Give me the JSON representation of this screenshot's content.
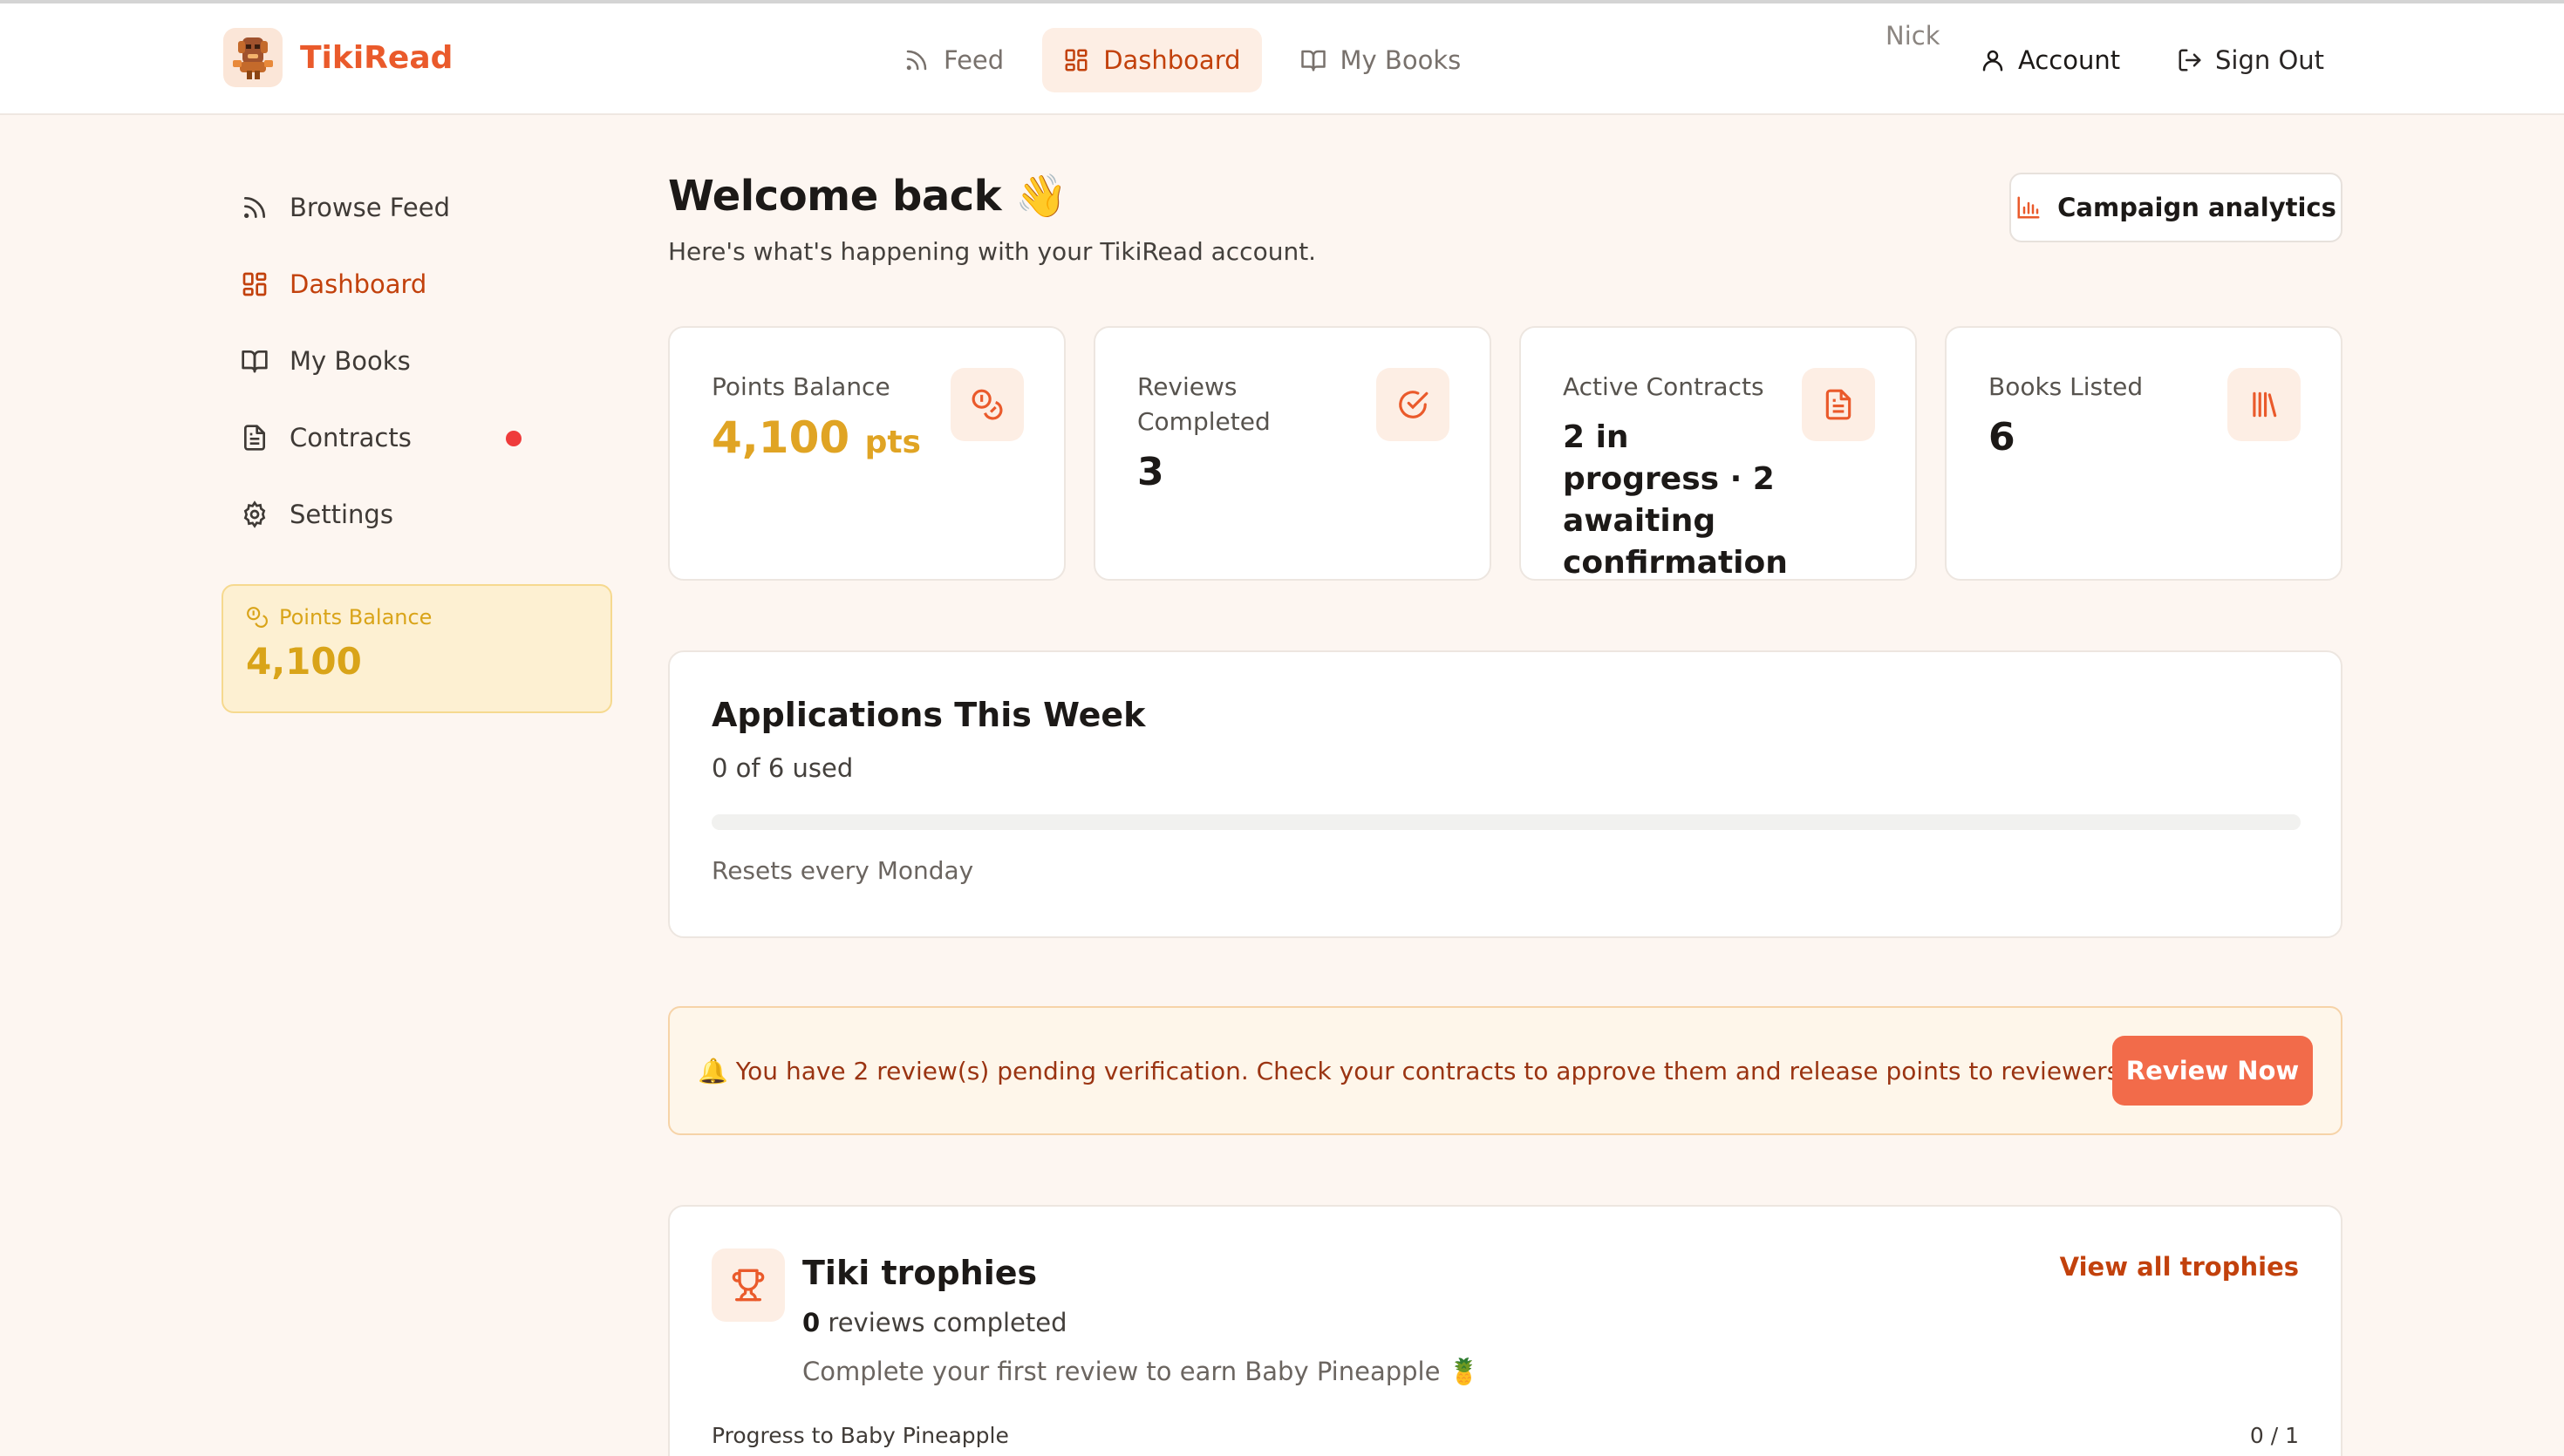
{
  "app": {
    "name": "TikiRead",
    "brand_color": "#ea5a2b",
    "accent_color": "#f26b4a",
    "gold_color": "#e0a424"
  },
  "topnav": {
    "items": [
      {
        "label": "Feed",
        "icon": "rss-icon",
        "active": false
      },
      {
        "label": "Dashboard",
        "icon": "dashboard-icon",
        "active": true
      },
      {
        "label": "My Books",
        "icon": "book-open-icon",
        "active": false
      }
    ],
    "user_name": "Nick",
    "account_label": "Account",
    "signout_label": "Sign Out"
  },
  "sidebar": {
    "items": [
      {
        "label": "Browse Feed",
        "icon": "rss-icon",
        "active": false
      },
      {
        "label": "Dashboard",
        "icon": "dashboard-icon",
        "active": true
      },
      {
        "label": "My Books",
        "icon": "book-open-icon",
        "active": false
      },
      {
        "label": "Contracts",
        "icon": "document-icon",
        "active": false,
        "has_notification": true
      },
      {
        "label": "Settings",
        "icon": "gear-icon",
        "active": false
      }
    ],
    "points": {
      "label": "Points Balance",
      "value": "4,100"
    }
  },
  "welcome": {
    "title": "Welcome back",
    "emoji": "👋",
    "subtitle": "Here's what's happening with your TikiRead account."
  },
  "analytics_button": {
    "label": "Campaign analytics",
    "icon": "bar-chart-icon"
  },
  "stats": [
    {
      "label": "Points Balance",
      "value": "4,100",
      "unit": "pts",
      "icon": "coins-icon"
    },
    {
      "label": "Reviews Completed",
      "value": "3",
      "icon": "check-circle-icon"
    },
    {
      "label": "Active Contracts",
      "value": "2 in progress · 2 awaiting confirmation",
      "icon": "document-icon"
    },
    {
      "label": "Books Listed",
      "value": "6",
      "icon": "library-icon"
    }
  ],
  "applications": {
    "title": "Applications This Week",
    "used_text": "0 of 6 used",
    "used": 0,
    "limit": 6,
    "reset_text": "Resets every Monday"
  },
  "pending": {
    "emoji": "🔔",
    "message": "You have 2 review(s) pending verification. Check your contracts to approve them and release points to reviewers.",
    "button_label": "Review Now"
  },
  "trophies": {
    "title": "Tiki trophies",
    "count": "0",
    "count_suffix": "reviews completed",
    "hint": "Complete your first review to earn Baby Pineapple 🍍",
    "view_all_label": "View all trophies",
    "progress_label": "Progress to Baby Pineapple",
    "progress_count": "0 / 1"
  }
}
